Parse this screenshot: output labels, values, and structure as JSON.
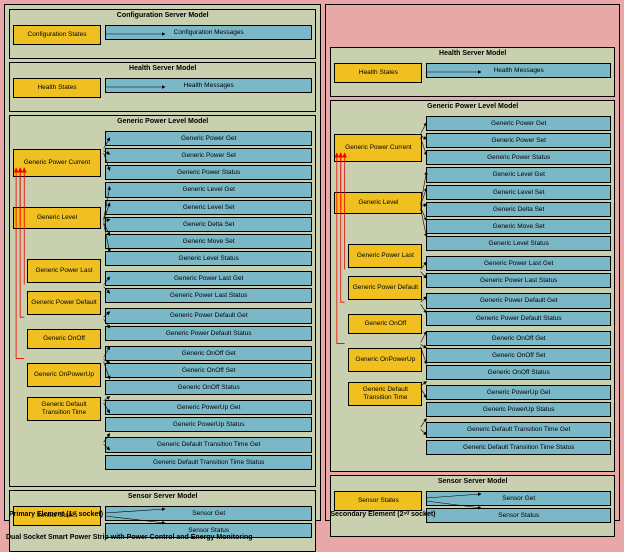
{
  "bottom_label": "Dual Socket Smart Power Strip with Power Control and Energy Monitoring",
  "primary_label": "Primary Element (1ˢᵗ socket)",
  "secondary_label": "Secondary Element (2ⁿᵈ socket)",
  "config_model": {
    "title": "Configuration Server Model",
    "state": "Configuration States",
    "msg": "Configuration Messages"
  },
  "health_model": {
    "title": "Health Server Model",
    "state": "Health States",
    "msg": "Health Messages"
  },
  "power_model": {
    "title": "Generic Power Level Model",
    "states": {
      "current": "Generic Power Current",
      "level": "Generic Level",
      "last": "Generic Power Last",
      "default": "Generic Power Default",
      "onoff": "Generic OnOff",
      "onpowerup": "Generic OnPowerUp",
      "transition": "Generic Default Transition Time"
    },
    "msgs": {
      "power_get": "Generic Power Get",
      "power_set": "Generic Power Set",
      "power_status": "Generic Power Status",
      "level_get": "Generic Level Get",
      "level_set": "Generic Level Set",
      "delta_set": "Generic Delta Set",
      "move_set": "Generic Move Set",
      "level_status": "Generic Level Status",
      "last_get": "Generic Power Last Get",
      "last_status": "Generic Power Last Status",
      "default_get": "Generic Power Default Get",
      "default_status": "Generic Power Default Status",
      "onoff_get": "Generic OnOff Get",
      "onoff_set": "Generic OnOff Set",
      "onoff_status": "Generic OnOff Status",
      "powerup_get": "Generic PowerUp Get",
      "powerup_status": "Generic PowerUp Status",
      "trans_get": "Generic Default Transition Time Get",
      "trans_status": "Generic Default Transition Time Status"
    }
  },
  "sensor_model": {
    "title": "Sensor Server Model",
    "state": "Sensor States",
    "msgs": {
      "get": "Sensor Get",
      "status": "Sensor Status"
    }
  }
}
